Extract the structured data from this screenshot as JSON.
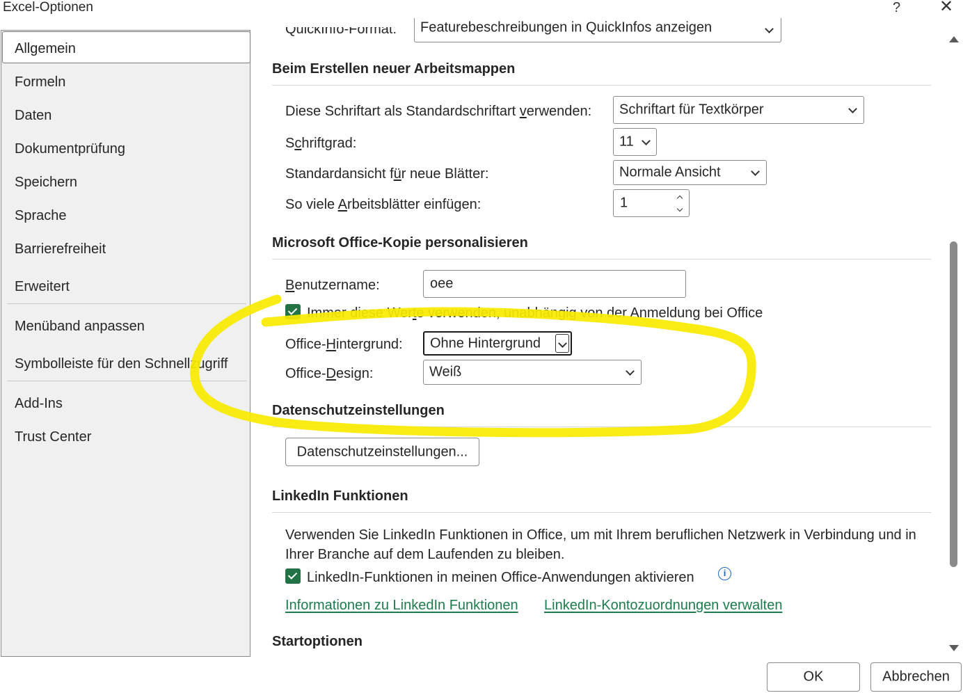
{
  "window": {
    "title": "Excel-Optionen",
    "help_label": "?",
    "close_label": "✕"
  },
  "sidebar": {
    "items": [
      {
        "label": "Allgemein",
        "selected": true
      },
      {
        "label": "Formeln"
      },
      {
        "label": "Daten"
      },
      {
        "label": "Dokumentprüfung"
      },
      {
        "label": "Speichern"
      },
      {
        "label": "Sprache"
      },
      {
        "label": "Barrierefreiheit"
      },
      {
        "label": "Erweitert"
      },
      {
        "label": "Menüband anpassen"
      },
      {
        "label": "Symbolleiste für den Schnellzugriff"
      },
      {
        "label": "Add-Ins"
      },
      {
        "label": "Trust Center"
      }
    ]
  },
  "top_cut": {
    "label": "QuickInfo-Format:",
    "value": "Featurebeschreibungen in QuickInfos anzeigen"
  },
  "new_workbooks": {
    "heading": "Beim Erstellen neuer Arbeitsmappen",
    "font_label_pre": "Diese Schriftart als Standardschriftart ",
    "font_label_key": "v",
    "font_label_post": "erwenden:",
    "font_value": "Schriftart für Textkörper",
    "size_label_pre": "S",
    "size_label_key": "c",
    "size_label_post": "hriftgrad:",
    "size_value": "11",
    "view_label_pre": "Standardansicht f",
    "view_label_key": "ü",
    "view_label_post": "r neue Blätter:",
    "view_value": "Normale Ansicht",
    "sheets_label_pre": "So viele ",
    "sheets_label_key": "A",
    "sheets_label_post": "rbeitsblätter einfügen:",
    "sheets_value": "1"
  },
  "personalize": {
    "heading": "Microsoft Office-Kopie personalisieren",
    "username_label_key": "B",
    "username_label_post": "enutzername:",
    "username_value": "oee",
    "always_pre": "Immer diese Wer",
    "always_key": "t",
    "always_post": "e verwenden, unabhängig von der Anmeldung bei Office",
    "always_checked": true,
    "background_label_pre": "Office-",
    "background_label_key": "H",
    "background_label_post": "intergrund:",
    "background_value": "Ohne Hintergrund",
    "design_label_pre": "Office-",
    "design_label_key": "D",
    "design_label_post": "esign:",
    "design_value": "Weiß"
  },
  "privacy": {
    "heading": "Datenschutzeinstellungen",
    "button_label": "Datenschutzeinstellungen..."
  },
  "linkedin": {
    "heading": "LinkedIn Funktionen",
    "description": "Verwenden Sie LinkedIn Funktionen in Office, um mit Ihrem beruflichen Netzwerk in Verbindung und in Ihrer Branche auf dem Laufenden zu bleiben.",
    "enable_label": "LinkedIn-Funktionen in meinen Office-Anwendungen aktivieren",
    "enable_checked": true,
    "info_glyph": "i",
    "link_info": "Informationen zu LinkedIn Funktionen",
    "link_manage": "LinkedIn-Kontozuordnungen verwalten"
  },
  "startup": {
    "heading": "Startoptionen"
  },
  "footer": {
    "ok_label": "OK",
    "cancel_label": "Abbrechen"
  },
  "colors": {
    "accent_green": "#217346",
    "link_green": "#1c7c4c",
    "annotation_yellow": "#f7ea00"
  }
}
